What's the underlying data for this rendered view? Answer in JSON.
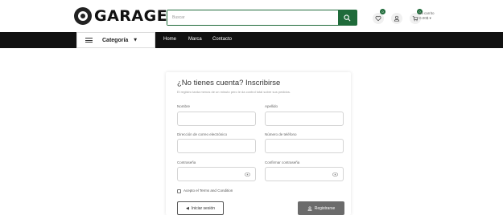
{
  "header": {
    "logo_text": "GARAGE",
    "search": {
      "placeholder": "Buscar"
    },
    "wishlist_count": "0",
    "cart_count": "0",
    "cart_label": "Mi carrito",
    "cart_total": "0.00$"
  },
  "nav": {
    "category_label": "Categoría",
    "links": [
      "Home",
      "Marca",
      "Contacto"
    ]
  },
  "form": {
    "title": "¿No tienes cuenta? Inscribirse",
    "subtitle": "El registro tarda menos de un minuto pero le da control total sobre sus pedidos.",
    "fields": {
      "nombre": "Nombre",
      "apellido": "Apellido",
      "email": "Dirección de correo electrónico",
      "telefono": "Número de teléfono",
      "password": "Contraseña",
      "confirm_password": "Confirmar contraseña"
    },
    "terms_label": "Acepto el Terms and Condition",
    "login_button": "Iniciar sesión",
    "register_button": "Registrarse"
  },
  "colors": {
    "brand_green": "#1f6b3a",
    "nav_black": "#111111",
    "register_gray": "#6b6b6b"
  }
}
